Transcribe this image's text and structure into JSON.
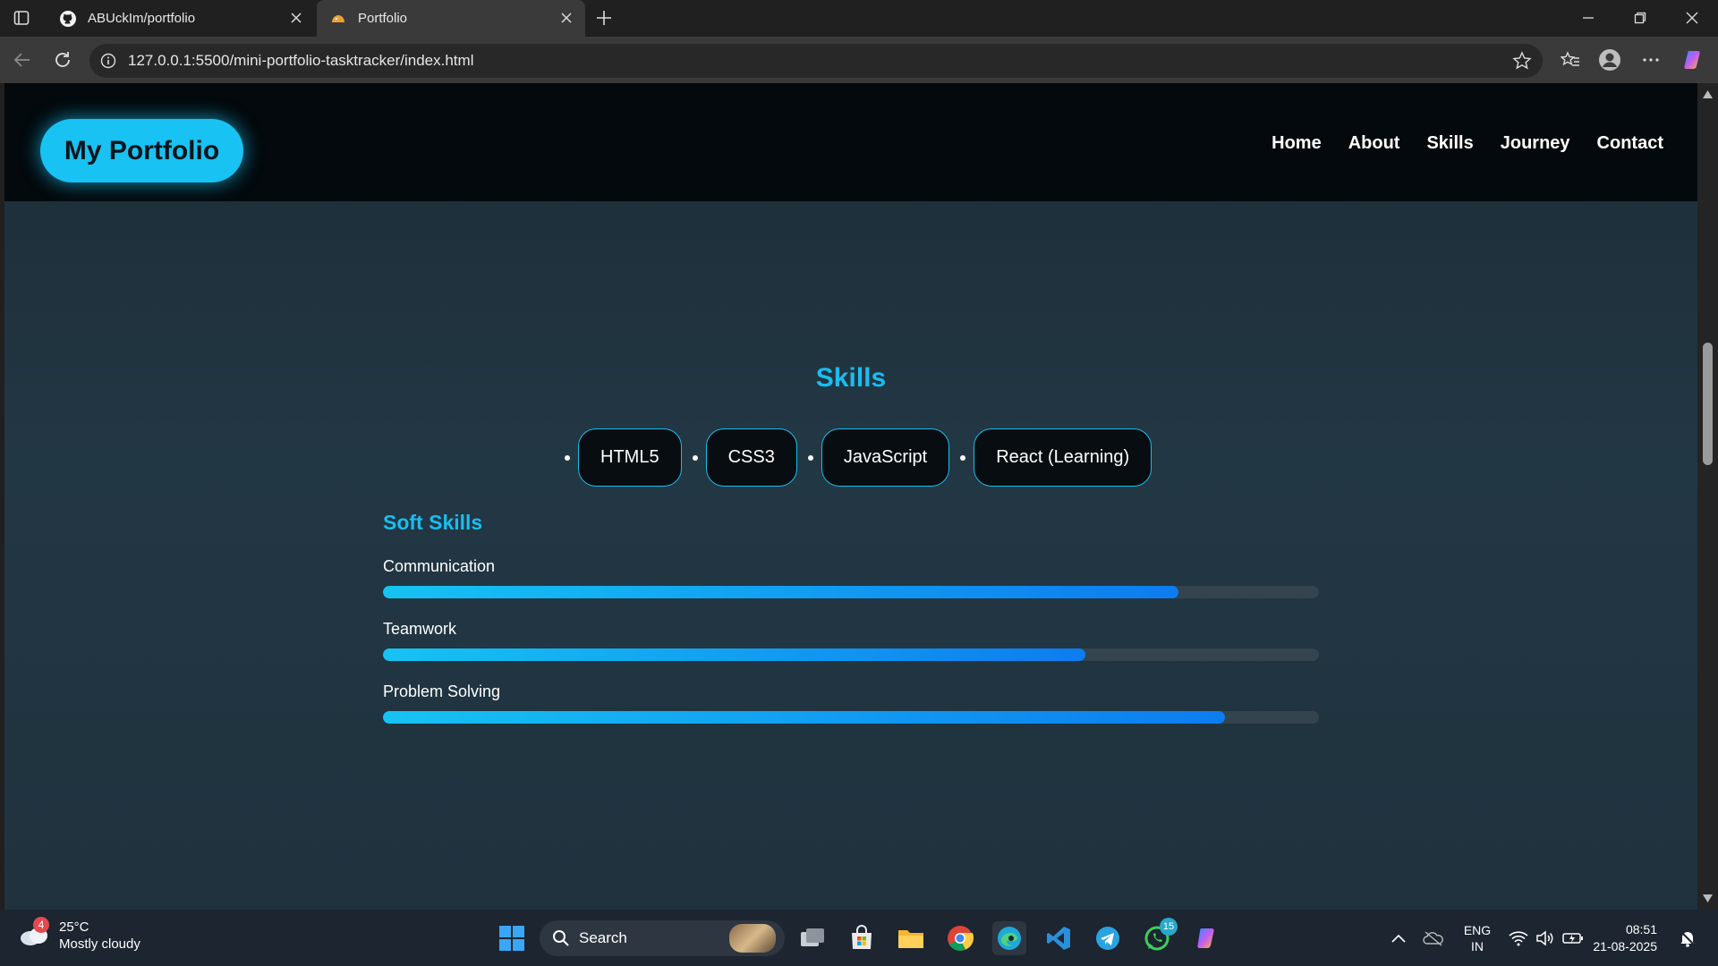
{
  "browser": {
    "tabs": [
      {
        "title": "ABUckIm/portfolio",
        "icon": "github-icon",
        "active": false
      },
      {
        "title": "Portfolio",
        "icon": "page-icon",
        "active": true
      }
    ],
    "url": "127.0.0.1:5500/mini-portfolio-tasktracker/index.html"
  },
  "site": {
    "logo": "My Portfolio",
    "nav": [
      "Home",
      "About",
      "Skills",
      "Journey",
      "Contact"
    ],
    "skills_title": "Skills",
    "chips": [
      "HTML5",
      "CSS3",
      "JavaScript",
      "React (Learning)"
    ],
    "soft_title": "Soft Skills",
    "soft_skills": [
      {
        "label": "Communication",
        "level_percent": 85
      },
      {
        "label": "Teamwork",
        "level_percent": 75
      },
      {
        "label": "Problem Solving",
        "level_percent": 90
      }
    ],
    "accent": "#19bdf0"
  },
  "taskbar": {
    "weather": {
      "temp": "25°C",
      "condition": "Mostly cloudy",
      "badge": "4"
    },
    "search_label": "Search",
    "whatsapp_badge": "15",
    "lang": [
      "ENG",
      "IN"
    ],
    "time": "08:51",
    "date": "21-08-2025"
  }
}
